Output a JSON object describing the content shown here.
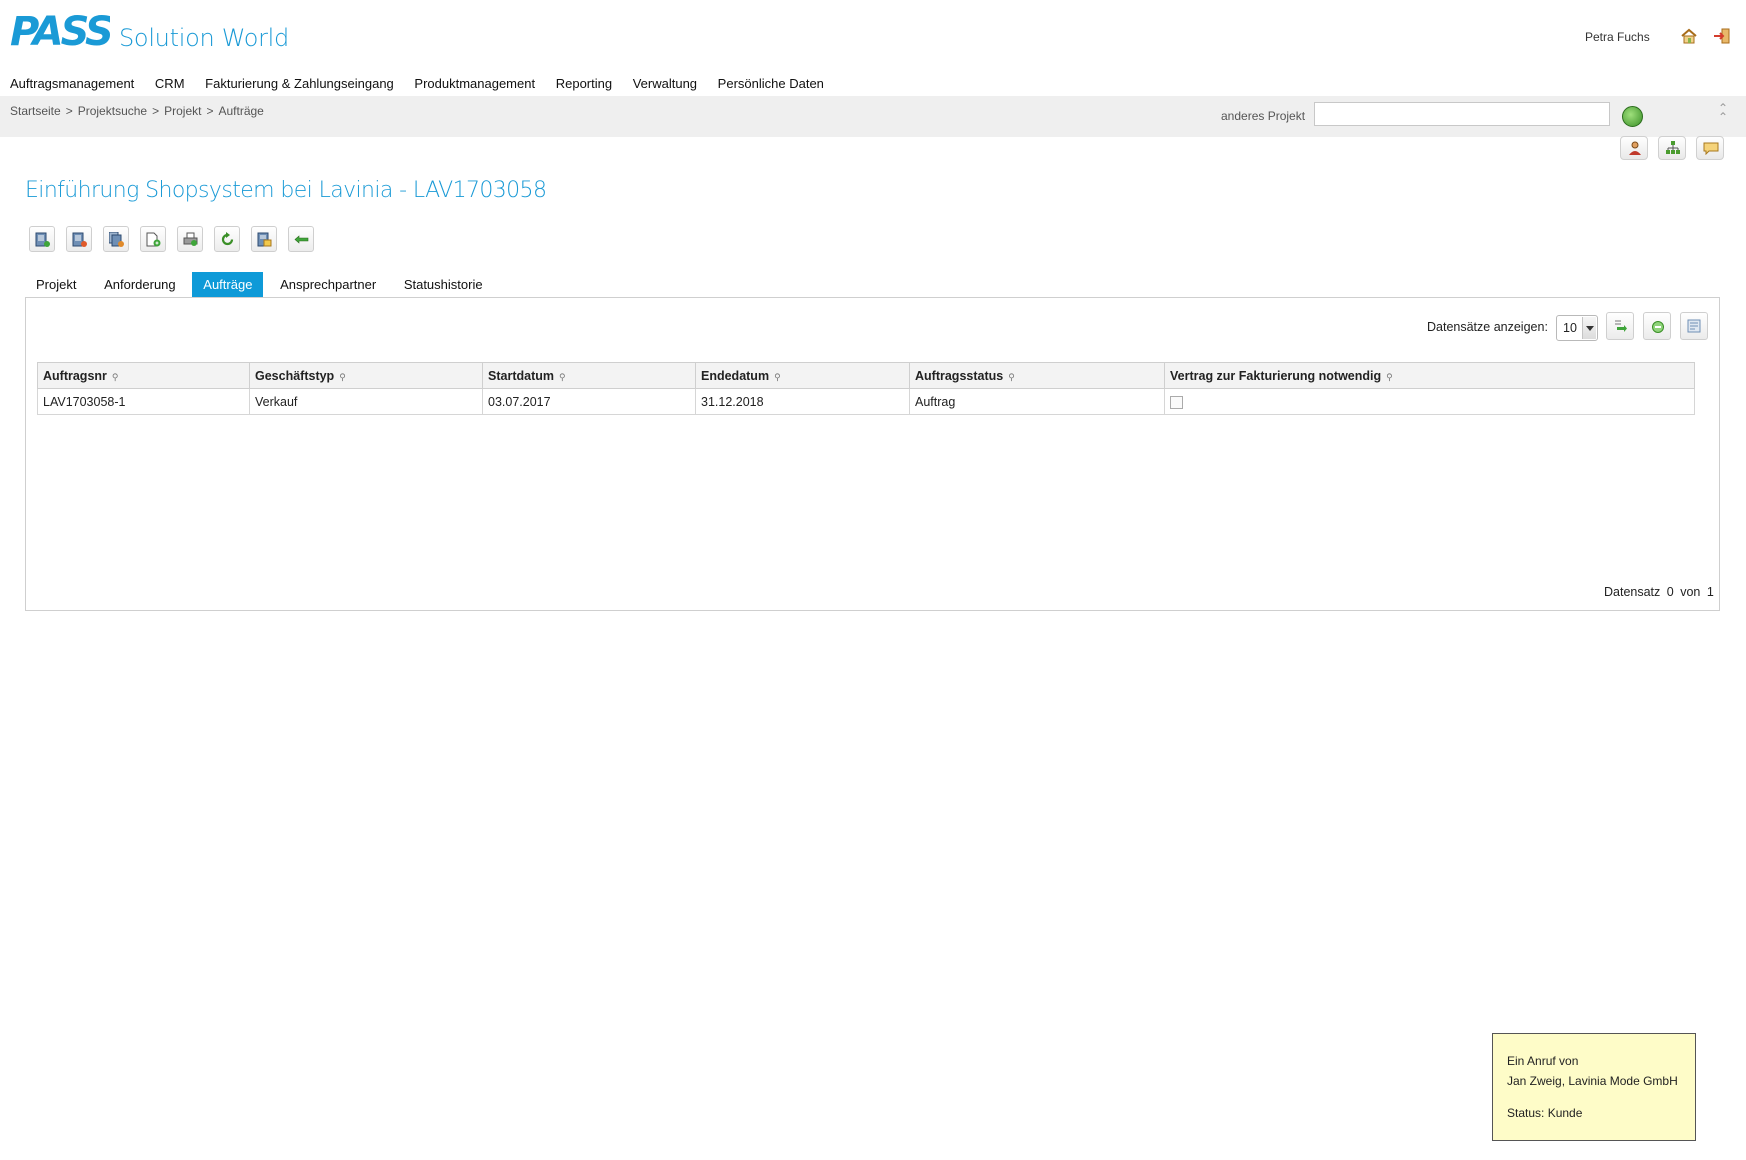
{
  "app": {
    "brand": "Solution World",
    "user": "Petra Fuchs"
  },
  "nav": [
    "Auftragsmanagement",
    "CRM",
    "Fakturierung & Zahlungseingang",
    "Produktmanagement",
    "Reporting",
    "Verwaltung",
    "Persönliche Daten"
  ],
  "breadcrumb": [
    "Startseite",
    "Projektsuche",
    "Projekt",
    "Aufträge"
  ],
  "breadcrumb_sep": ">",
  "project_search": {
    "label": "anderes Projekt",
    "value": ""
  },
  "page": {
    "title": "Einführung Shopsystem bei Lavinia -  LAV1703058"
  },
  "tabs": [
    {
      "label": "Projekt",
      "active": false
    },
    {
      "label": "Anforderung",
      "active": false
    },
    {
      "label": "Aufträge",
      "active": true
    },
    {
      "label": "Ansprechpartner",
      "active": false
    },
    {
      "label": "Statushistorie",
      "active": false
    }
  ],
  "records": {
    "label": "Datensätze anzeigen:",
    "per_page": "10"
  },
  "table": {
    "columns": [
      "Auftragsnr",
      "Geschäftstyp",
      "Startdatum",
      "Endedatum",
      "Auftragsstatus",
      "Vertrag zur Fakturierung notwendig"
    ],
    "rows": [
      {
        "auftragsnr": "LAV1703058-1",
        "geschaeftstyp": "Verkauf",
        "startdatum": "03.07.2017",
        "endedatum": "31.12.2018",
        "status": "Auftrag",
        "vertrag_checked": false
      }
    ]
  },
  "footer": {
    "label": "Datensatz",
    "current": "0",
    "of_label": "von",
    "total": "1"
  },
  "notification": {
    "line1": "Ein Anruf von",
    "line2": "Jan Zweig, Lavinia Mode GmbH",
    "line3": "Status: Kunde"
  },
  "colors": {
    "accent": "#1a9ad6",
    "tab_active": "#0e9ad8",
    "note_bg": "#fefcc8"
  },
  "icons": {
    "header": [
      "home-icon",
      "logout-icon"
    ],
    "side": [
      "contact-person-icon",
      "hierarchy-icon",
      "message-icon"
    ],
    "toolbar": [
      "new-order-icon",
      "delete-order-icon",
      "copy-order-icon",
      "add-document-icon",
      "print-icon",
      "refresh-icon",
      "export-icon",
      "back-icon"
    ],
    "panel": [
      "export-records-icon",
      "add-record-icon",
      "settings-icon"
    ]
  }
}
